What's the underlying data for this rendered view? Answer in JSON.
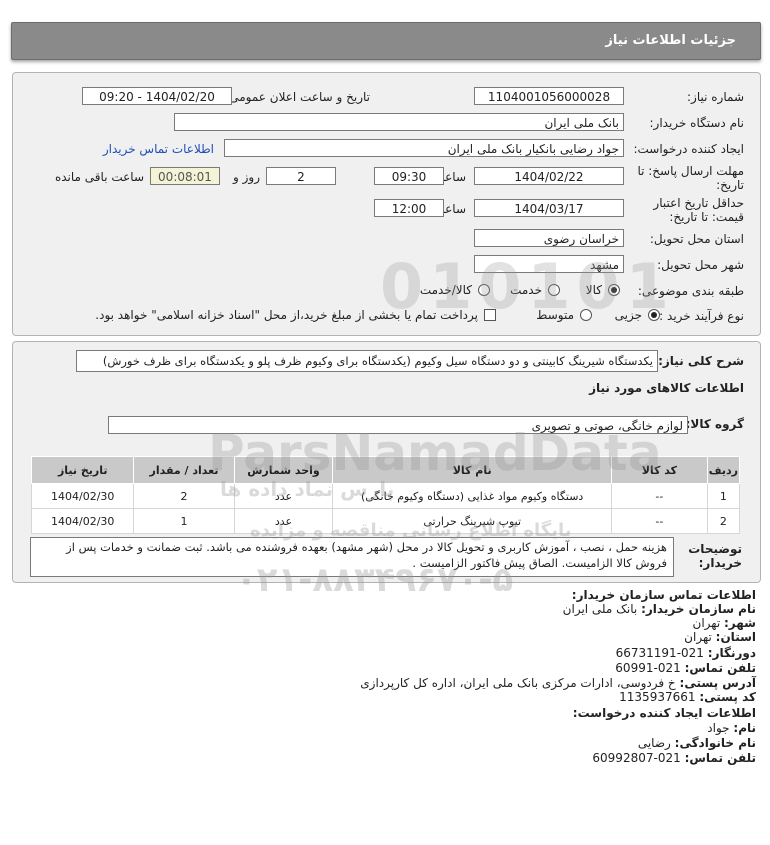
{
  "header": {
    "title": "جزئیات اطلاعات نیاز"
  },
  "form": {
    "need_number_label": "شماره نیاز:",
    "need_number": "1104001056000028",
    "announce_label": "تاریخ و ساعت اعلان عمومی:",
    "announce_value": "1404/02/20 - 09:20",
    "buyer_org_label": "نام دستگاه خریدار:",
    "buyer_org": "بانک ملی ایران",
    "requester_label": "ایجاد کننده درخواست:",
    "requester": "جواد رضایی بانکیار بانک ملی ایران",
    "contact_link": "اطلاعات تماس خریدار",
    "deadline_label_1": "مهلت ارسال پاسخ: تا",
    "deadline_label_2": "تاریخ:",
    "deadline_date": "1404/02/22",
    "time_label": "ساعت",
    "deadline_time": "09:30",
    "days_value": "2",
    "days_label": "روز و",
    "remaining_time": "00:08:01",
    "remaining_label": "ساعت باقی مانده",
    "validity_label_1": "حداقل تاریخ اعتبار",
    "validity_label_2": "قیمت: تا تاریخ:",
    "validity_date": "1404/03/17",
    "validity_time": "12:00",
    "province_label": "استان محل تحویل:",
    "province": "خراسان رضوی",
    "city_label": "شهر محل تحویل:",
    "city": "مشهد",
    "category_label": "طبقه بندی موضوعی:",
    "category_options": [
      "کالا",
      "خدمت",
      "کالا/خدمت"
    ],
    "process_label": "نوع فرآیند خرید :",
    "process_options": [
      "جزیی",
      "متوسط"
    ],
    "payment_note": "پرداخت تمام یا بخشی از مبلغ خرید،از محل \"اسناد خزانه اسلامی\" خواهد بود."
  },
  "summary": {
    "label": "شرح کلی نیاز:",
    "text": "یکدستگاه شیرینگ کابینتی و دو دستگاه سیل وکیوم (یکدستگاه برای وکیوم ظرف پلو و یکدستگاه برای ظرف خورش)",
    "goods_info_label": "اطلاعات کالاهای مورد نیاز",
    "group_label": "گروه کالا:",
    "group_value": "لوازم خانگی، صوتی و تصویری"
  },
  "table": {
    "headers": [
      "ردیف",
      "کد کالا",
      "نام کالا",
      "واحد شمارش",
      "تعداد / مقدار",
      "تاریخ نیاز"
    ],
    "rows": [
      [
        "1",
        "--",
        "دستگاه وکیوم مواد غذایی (دستگاه وکیوم خانگی)",
        "عدد",
        "2",
        "1404/02/30"
      ],
      [
        "2",
        "--",
        "تیوپ شیرینگ حرارتی",
        "عدد",
        "1",
        "1404/02/30"
      ]
    ]
  },
  "notes": {
    "label_1": "توضیحات",
    "label_2": "خریدار:",
    "text": "هزینه حمل ، نصب ، آموزش کاربری و تحویل کالا در محل (شهر مشهد) بعهده فروشنده می باشد. ثبت ضمانت و خدمات پس از فروش کالا الزامیست. الصاق پیش فاکتور الزامیست ."
  },
  "buyer_contact": {
    "title": "اطلاعات تماس سازمان خریدار:",
    "org_label": "نام سازمان خریدار:",
    "org": "بانک ملی ایران",
    "city_label": "شهر:",
    "city": "تهران",
    "province_label": "استان:",
    "province": "تهران",
    "phone_label": "دورنگار:",
    "phone": "021-66731191",
    "tel_label": "تلفن تماس:",
    "tel": "021-60991",
    "address_label": "آدرس پستی:",
    "address": "خ فردوسی، ادارات مرکزی بانک ملی ایران، اداره کل کارپردازی",
    "postal_label": "کد پستی:",
    "postal": "1135937661"
  },
  "creator_contact": {
    "title": "اطلاعات ایجاد کننده درخواست:",
    "name_label": "نام:",
    "name": "جواد",
    "family_label": "نام خانوادگی:",
    "family": "رضایی",
    "tel_label": "تلفن تماس:",
    "tel": "021-60992807"
  },
  "watermark": {
    "brand": "ParsNamadData",
    "persian": "پارس نماد داده ها",
    "sub": "پایگاه اطلاع رسانی مناقصه و مزایده",
    "phone": "۰۲۱-۸۸۳۴۹۶۷۰-۵",
    "digits": "010101"
  },
  "colors": {
    "header_bg": "#8a8a8a",
    "panel_bg": "#f0f0f0",
    "link": "#1f4fb8",
    "table_header": "#c9c9c9"
  }
}
